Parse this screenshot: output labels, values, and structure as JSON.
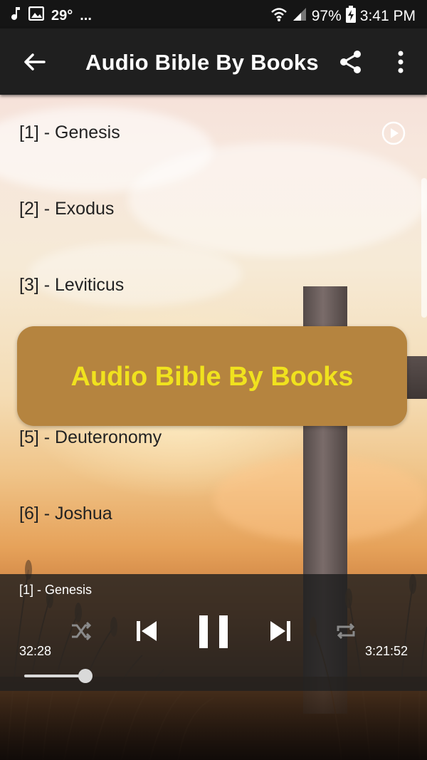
{
  "status_bar": {
    "temperature": "29°",
    "more": "...",
    "battery": "97%",
    "time": "3:41 PM"
  },
  "app_bar": {
    "title": "Audio Bible By Books"
  },
  "books": [
    {
      "label": "[1] - Genesis"
    },
    {
      "label": "[2] - Exodus"
    },
    {
      "label": "[3] - Leviticus"
    },
    {
      "label": ""
    },
    {
      "label": "[5] - Deuteronomy"
    },
    {
      "label": "[6] - Joshua"
    }
  ],
  "banner": {
    "text": "Audio Bible By Books"
  },
  "player": {
    "now_playing": "[1] - Genesis",
    "elapsed": "32:28",
    "total": "3:21:52",
    "progress_fraction": 0.167
  },
  "colors": {
    "banner_bg": "#b5843f",
    "banner_text": "#f0e21e",
    "app_bar_bg": "#1f1f1f"
  }
}
